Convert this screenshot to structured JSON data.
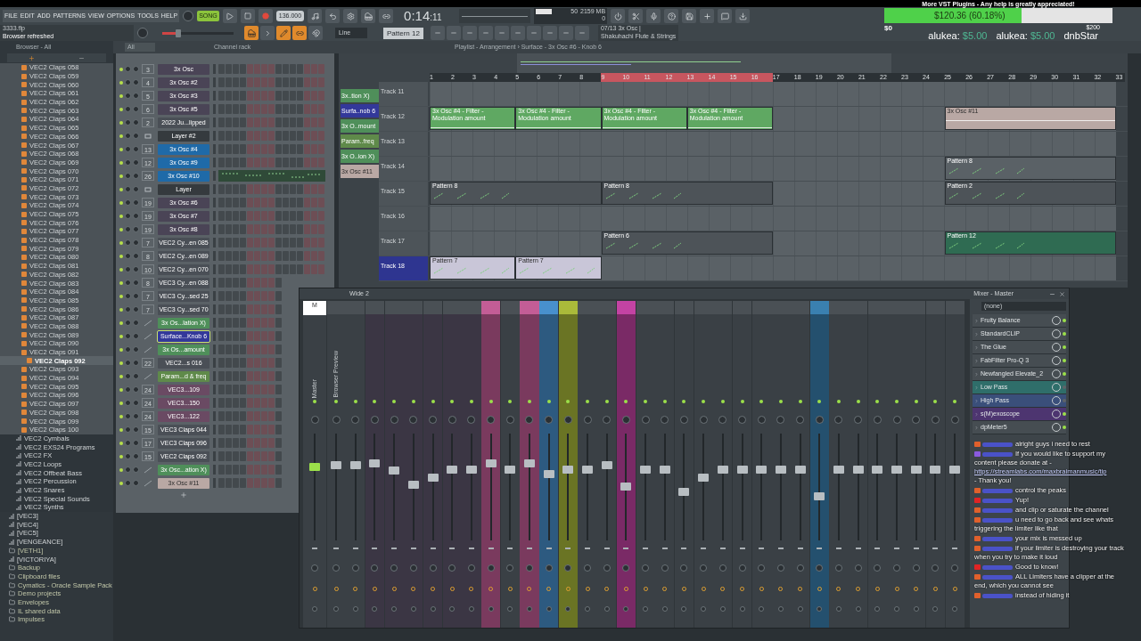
{
  "overlay": {
    "title": "More VST Plugins - Any help is greatly appreciated!",
    "amount": "$120.36 (60.18%)",
    "level": 0.6018,
    "min": "$0",
    "max": "$200",
    "donors": [
      {
        "name": "alukea:",
        "amount": "$5.00"
      },
      {
        "name": "alukea:",
        "amount": "$5.00"
      },
      {
        "name": "dnbStar"
      }
    ]
  },
  "toolbar": {
    "menu": [
      "FILE",
      "EDIT",
      "ADD",
      "PATTERNS",
      "VIEW",
      "OPTIONS",
      "TOOLS",
      "HELP"
    ],
    "mode": "SONG",
    "tempo": "136.000",
    "time": "0:14",
    "time_sub": ":11",
    "master_slider": {
      "level": 0.22
    },
    "cpu": "50",
    "memory": "2159 MB",
    "polyphony": "0",
    "project": "3333.flp",
    "status": "Browser refreshed",
    "snap": "Line",
    "pattern": "Pattern 12",
    "hint_top": "07/13  3x Osc |",
    "hint_bottom": "Shakuhachi Flute & Strings"
  },
  "browser": {
    "title": "Browser - All",
    "items": [
      {
        "name": "VEC2 Claps 058",
        "kind": "sample",
        "selected": false
      },
      {
        "name": "VEC2 Claps 059",
        "kind": "sample",
        "selected": false
      },
      {
        "name": "VEC2 Claps 060",
        "kind": "sample",
        "selected": false
      },
      {
        "name": "VEC2 Claps 061",
        "kind": "sample",
        "selected": false
      },
      {
        "name": "VEC2 Claps 062",
        "kind": "sample",
        "selected": false
      },
      {
        "name": "VEC2 Claps 063",
        "kind": "sample",
        "selected": false
      },
      {
        "name": "VEC2 Claps 064",
        "kind": "sample",
        "selected": false
      },
      {
        "name": "VEC2 Claps 065",
        "kind": "sample",
        "selected": false
      },
      {
        "name": "VEC2 Claps 066",
        "kind": "sample",
        "selected": false
      },
      {
        "name": "VEC2 Claps 067",
        "kind": "sample",
        "selected": false
      },
      {
        "name": "VEC2 Claps 068",
        "kind": "sample",
        "selected": false
      },
      {
        "name": "VEC2 Claps 069",
        "kind": "sample",
        "selected": false
      },
      {
        "name": "VEC2 Claps 070",
        "kind": "sample",
        "selected": false
      },
      {
        "name": "VEC2 Claps 071",
        "kind": "sample",
        "selected": false
      },
      {
        "name": "VEC2 Claps 072",
        "kind": "sample",
        "selected": false
      },
      {
        "name": "VEC2 Claps 073",
        "kind": "sample",
        "selected": false
      },
      {
        "name": "VEC2 Claps 074",
        "kind": "sample",
        "selected": false
      },
      {
        "name": "VEC2 Claps 075",
        "kind": "sample",
        "selected": false
      },
      {
        "name": "VEC2 Claps 076",
        "kind": "sample",
        "selected": false
      },
      {
        "name": "VEC2 Claps 077",
        "kind": "sample",
        "selected": false
      },
      {
        "name": "VEC2 Claps 078",
        "kind": "sample",
        "selected": false
      },
      {
        "name": "VEC2 Claps 079",
        "kind": "sample",
        "selected": false
      },
      {
        "name": "VEC2 Claps 080",
        "kind": "sample",
        "selected": false
      },
      {
        "name": "VEC2 Claps 081",
        "kind": "sample",
        "selected": false
      },
      {
        "name": "VEC2 Claps 082",
        "kind": "sample",
        "selected": false
      },
      {
        "name": "VEC2 Claps 083",
        "kind": "sample",
        "selected": false
      },
      {
        "name": "VEC2 Claps 084",
        "kind": "sample",
        "selected": false
      },
      {
        "name": "VEC2 Claps 085",
        "kind": "sample",
        "selected": false
      },
      {
        "name": "VEC2 Claps 086",
        "kind": "sample",
        "selected": false
      },
      {
        "name": "VEC2 Claps 087",
        "kind": "sample",
        "selected": false
      },
      {
        "name": "VEC2 Claps 088",
        "kind": "sample",
        "selected": false
      },
      {
        "name": "VEC2 Claps 089",
        "kind": "sample",
        "selected": false
      },
      {
        "name": "VEC2 Claps 090",
        "kind": "sample",
        "selected": false
      },
      {
        "name": "VEC2 Claps 091",
        "kind": "sample",
        "selected": false
      },
      {
        "name": "VEC2 Claps 092",
        "kind": "sample",
        "selected": true
      },
      {
        "name": "VEC2 Claps 093",
        "kind": "sample",
        "selected": false
      },
      {
        "name": "VEC2 Claps 094",
        "kind": "sample",
        "selected": false
      },
      {
        "name": "VEC2 Claps 095",
        "kind": "sample",
        "selected": false
      },
      {
        "name": "VEC2 Claps 096",
        "kind": "sample",
        "selected": false
      },
      {
        "name": "VEC2 Claps 097",
        "kind": "sample",
        "selected": false
      },
      {
        "name": "VEC2 Claps 098",
        "kind": "sample",
        "selected": false
      },
      {
        "name": "VEC2 Claps 099",
        "kind": "sample",
        "selected": false
      },
      {
        "name": "VEC2 Claps 100",
        "kind": "sample",
        "selected": false
      },
      {
        "name": "VEC2 Cymbals",
        "kind": "subfolder",
        "selected": false
      },
      {
        "name": "VEC2 EXS24 Programs",
        "kind": "subfolder",
        "selected": false
      },
      {
        "name": "VEC2 FX",
        "kind": "subfolder",
        "selected": false
      },
      {
        "name": "VEC2 Loops",
        "kind": "subfolder",
        "selected": false
      },
      {
        "name": "VEC2 Offbeat Bass",
        "kind": "subfolder",
        "selected": false
      },
      {
        "name": "VEC2 Percussion",
        "kind": "subfolder",
        "selected": false
      },
      {
        "name": "VEC2 Snares",
        "kind": "subfolder",
        "selected": false
      },
      {
        "name": "VEC2 Special Sounds",
        "kind": "subfolder",
        "selected": false
      },
      {
        "name": "VEC2 Synths",
        "kind": "subfolder",
        "selected": false
      },
      {
        "name": "[VEC3]",
        "kind": "pack",
        "selected": false
      },
      {
        "name": "[VEC4]",
        "kind": "pack",
        "selected": false
      },
      {
        "name": "[VEC5]",
        "kind": "pack",
        "selected": false
      },
      {
        "name": "[VENGEANCE]",
        "kind": "pack",
        "selected": false
      },
      {
        "name": "[VETH1]",
        "kind": "folder",
        "selected": false
      },
      {
        "name": "[VICTORIYA]",
        "kind": "pack",
        "selected": false
      },
      {
        "name": "Backup",
        "kind": "folder",
        "selected": false
      },
      {
        "name": "Clipboard files",
        "kind": "folder",
        "selected": false
      },
      {
        "name": "Cymatics - Oracle Sample Pack",
        "kind": "folder",
        "selected": false
      },
      {
        "name": "Demo projects",
        "kind": "folder",
        "selected": false
      },
      {
        "name": "Envelopes",
        "kind": "folder",
        "selected": false
      },
      {
        "name": "IL shared data",
        "kind": "folder",
        "selected": false
      },
      {
        "name": "Impulses",
        "kind": "folder",
        "selected": false
      }
    ]
  },
  "channel_rack": {
    "title": "Channel rack",
    "filter": "All",
    "channels": [
      {
        "number": "3",
        "name": "3x Osc",
        "kind": "instrument",
        "color": "#4a4456",
        "selected": false
      },
      {
        "number": "4",
        "name": "3x Osc #2",
        "kind": "instrument",
        "color": "#4a4456",
        "selected": false
      },
      {
        "number": "5",
        "name": "3x Osc #3",
        "kind": "instrument",
        "color": "#4a4456",
        "selected": false
      },
      {
        "number": "6",
        "name": "3x Osc #5",
        "kind": "instrument",
        "color": "#4a4456",
        "selected": false
      },
      {
        "number": "2",
        "name": "2022 Ju...lipped",
        "kind": "instrument",
        "color": "#4a4f56",
        "selected": false
      },
      {
        "name": "Layer #2",
        "kind": "layer",
        "color": "#353a3e",
        "selected": false
      },
      {
        "number": "13",
        "name": "3x Osc #4",
        "kind": "instrument",
        "color": "#1f6aa8",
        "selected": false
      },
      {
        "number": "12",
        "name": "3x Osc #9",
        "kind": "instrument",
        "color": "#1f6aa8",
        "selected": false
      },
      {
        "number": "26",
        "name": "3x Osc #10",
        "kind": "pianoroll",
        "color": "#1f6aa8",
        "selected": false
      },
      {
        "name": "Layer",
        "kind": "layer",
        "color": "#353a3e",
        "selected": false
      },
      {
        "number": "19",
        "name": "3x Osc #6",
        "kind": "instrument",
        "color": "#4a4456",
        "selected": false
      },
      {
        "number": "19",
        "name": "3x Osc #7",
        "kind": "instrument",
        "color": "#4a4456",
        "selected": false
      },
      {
        "number": "19",
        "name": "3x Osc #8",
        "kind": "instrument",
        "color": "#4a4456",
        "selected": false
      },
      {
        "number": "7",
        "name": "VEC2 Cy...en 085",
        "kind": "instrument",
        "color": "#4a4f56",
        "selected": false
      },
      {
        "number": "8",
        "name": "VEC2 Cy...en 089",
        "kind": "instrument",
        "color": "#4a4f56",
        "selected": false
      },
      {
        "number": "10",
        "name": "VEC2 Cy...en 070",
        "kind": "instrument",
        "color": "#4a4f56",
        "selected": false
      },
      {
        "number": "8",
        "name": "VEC3 Cy...en 088",
        "kind": "instrument",
        "color": "#4a4f56",
        "selected": false
      },
      {
        "number": "7",
        "name": "VEC3 Cy...sed 25",
        "kind": "instrument",
        "color": "#4a4f56",
        "selected": false
      },
      {
        "number": "7",
        "name": "VEC3 Cy...sed 70",
        "kind": "instrument",
        "color": "#4a4f56",
        "selected": false
      },
      {
        "name": "3x Os...lation X)",
        "kind": "automation",
        "color": "#4f8f5a",
        "selected": false
      },
      {
        "name": "Surface...Knob 6",
        "kind": "automation",
        "color": "#33389a",
        "selected": true
      },
      {
        "name": "3x Os...amount",
        "kind": "automation",
        "color": "#4f8f5a",
        "selected": false
      },
      {
        "number": "22",
        "name": "VEC2...s 016",
        "kind": "sampler",
        "color": "#4a4f56",
        "selected": false
      },
      {
        "name": "Param...d & freq",
        "kind": "automation",
        "color": "#5f8a4a",
        "selected": false
      },
      {
        "number": "24",
        "name": "VEC3...109",
        "kind": "sampler",
        "color": "#6a4a63",
        "selected": false
      },
      {
        "number": "24",
        "name": "VEC3...150",
        "kind": "sampler",
        "color": "#6a4a63",
        "selected": false
      },
      {
        "number": "24",
        "name": "VEC3...122",
        "kind": "sampler",
        "color": "#6a4a63",
        "selected": false
      },
      {
        "number": "15",
        "name": "VEC3 Claps 044",
        "kind": "instrument",
        "color": "#4a4f56",
        "selected": false
      },
      {
        "number": "17",
        "name": "VEC3 Claps 096",
        "kind": "instrument",
        "color": "#4a4f56",
        "selected": false
      },
      {
        "number": "15",
        "name": "VEC2 Claps 092",
        "kind": "instrument",
        "color": "#4a4f56",
        "selected": false
      },
      {
        "name": "3x Osc...ation X)",
        "kind": "automation",
        "color": "#4f8f5a",
        "selected": false
      },
      {
        "name": "3x Osc #11",
        "kind": "automation",
        "color": "#b9a8a4",
        "selected": false
      }
    ]
  },
  "playlist": {
    "title": "Playlist - Arrangement › Surface - 3x Osc #6 - Knob 6",
    "picker": [
      {
        "name": "3x..tion X)",
        "color": "#4f8f5a"
      },
      {
        "name": "Surfa..nob 6",
        "color": "#33389a"
      },
      {
        "name": "3x O..mount",
        "color": "#4f8f5a"
      },
      {
        "name": "Param..freq",
        "color": "#5f8a4a"
      },
      {
        "name": "3x O..ion X)",
        "color": "#4f8f5a"
      },
      {
        "name": "3x Osc #11",
        "color": "#b9a8a4"
      }
    ],
    "ruler": [
      {
        "label": "1",
        "selected": false
      },
      {
        "label": "2",
        "selected": false
      },
      {
        "label": "3",
        "selected": false
      },
      {
        "label": "4",
        "selected": false
      },
      {
        "label": "5",
        "selected": false
      },
      {
        "label": "6",
        "selected": false
      },
      {
        "label": "7",
        "selected": false
      },
      {
        "label": "8",
        "selected": false
      },
      {
        "label": "9",
        "selected": true
      },
      {
        "label": "10",
        "selected": true
      },
      {
        "label": "11",
        "selected": true
      },
      {
        "label": "12",
        "selected": true
      },
      {
        "label": "13",
        "selected": true
      },
      {
        "label": "14",
        "selected": true
      },
      {
        "label": "15",
        "selected": true
      },
      {
        "label": "16",
        "selected": true
      },
      {
        "label": "17",
        "selected": false
      },
      {
        "label": "18",
        "selected": false
      },
      {
        "label": "19",
        "selected": false
      },
      {
        "label": "20",
        "selected": false
      },
      {
        "label": "21",
        "selected": false
      },
      {
        "label": "22",
        "selected": false
      },
      {
        "label": "23",
        "selected": false
      },
      {
        "label": "24",
        "selected": false
      },
      {
        "label": "25",
        "selected": false
      },
      {
        "label": "26",
        "selected": false
      },
      {
        "label": "27",
        "selected": false
      },
      {
        "label": "28",
        "selected": false
      },
      {
        "label": "29",
        "selected": false
      },
      {
        "label": "30",
        "selected": false
      },
      {
        "label": "31",
        "selected": false
      },
      {
        "label": "32",
        "selected": false
      },
      {
        "label": "33",
        "selected": false
      }
    ],
    "tracks": [
      {
        "name": "Track 11",
        "selected": false
      },
      {
        "name": "Track 12",
        "selected": false,
        "cells": [
          {
            "label": "3x Osc #4 - Filter - Modulation amount",
            "kind": "automation",
            "color": "#5fa862"
          },
          {
            "label": "3x Osc #4 - Filter - Modulation amount",
            "kind": "automation",
            "color": "#5fa862"
          },
          {
            "label": "3x Osc #4 - Filter - Modulation amount",
            "kind": "automation",
            "color": "#5fa862"
          },
          {
            "label": "3x Osc #4 - Filter - Modulation amount",
            "kind": "automation",
            "color": "#5fa862"
          },
          {
            "kind": "empty"
          },
          {
            "kind": "empty"
          },
          {
            "label": "3x Osc #11",
            "kind": "automation",
            "color": "#b9a8a4"
          },
          {
            "kind": "continued"
          }
        ]
      },
      {
        "name": "Track 13",
        "selected": false
      },
      {
        "name": "Track 14",
        "selected": false,
        "cells": [
          {
            "kind": "empty"
          },
          {
            "kind": "empty"
          },
          {
            "kind": "empty"
          },
          {
            "kind": "empty"
          },
          {
            "kind": "empty"
          },
          {
            "kind": "empty"
          },
          {
            "label": "Pattern 8",
            "kind": "pattern",
            "color": "#5a6166"
          },
          {
            "kind": "continued"
          }
        ]
      },
      {
        "name": "Track 15",
        "selected": false,
        "cells": [
          {
            "label": "Pattern 8",
            "kind": "pattern",
            "color": "#4d5358"
          },
          {
            "kind": "continued"
          },
          {
            "label": "Pattern 8",
            "kind": "pattern",
            "color": "#4d5358"
          },
          {
            "kind": "continued"
          },
          {
            "kind": "empty"
          },
          {
            "kind": "empty"
          },
          {
            "label": "Pattern 2",
            "kind": "pattern",
            "color": "#4d5358"
          },
          {
            "kind": "continued"
          }
        ]
      },
      {
        "name": "Track 16",
        "selected": false
      },
      {
        "name": "Track 17",
        "selected": false,
        "cells": [
          {
            "kind": "empty"
          },
          {
            "kind": "empty"
          },
          {
            "label": "Pattern 6",
            "kind": "pattern",
            "color": "#4d5358"
          },
          {
            "kind": "continued"
          },
          {
            "kind": "empty"
          },
          {
            "kind": "empty"
          },
          {
            "label": "Pattern 12",
            "kind": "pattern",
            "color": "#2f6b52"
          },
          {
            "kind": "continued"
          }
        ]
      },
      {
        "name": "Track 18",
        "selected": true,
        "cells": [
          {
            "label": "Pattern 7",
            "kind": "pattern",
            "color": "#c9c6d8"
          },
          {
            "label": "Pattern 7",
            "kind": "pattern",
            "color": "#c9c6d8"
          }
        ]
      }
    ]
  },
  "mixer": {
    "title": "Wide 2",
    "strips": [
      {
        "number": "M",
        "label": "Master",
        "level": 0.68
      },
      {
        "label": "Browser Preview",
        "level": 0.7
      },
      {
        "level": 0.7
      },
      {
        "level": 0.72
      },
      {
        "level": 0.65
      },
      {
        "level": 0.52
      },
      {
        "level": 0.58
      },
      {
        "level": 0.66
      },
      {
        "level": 0.66
      },
      {
        "level": 0.72,
        "color": "#7a3a5e"
      },
      {
        "level": 0.66
      },
      {
        "level": 0.72,
        "color": "#7a3a5e"
      },
      {
        "level": 0.62,
        "color": "#2d5a80"
      },
      {
        "level": 0.66,
        "color": "#6a7424"
      },
      {
        "level": 0.66
      },
      {
        "level": 0.7
      },
      {
        "level": 0.5,
        "color": "#7a2a66"
      },
      {
        "level": 0.66
      },
      {
        "level": 0.66
      },
      {
        "level": 0.45
      },
      {
        "level": 0.58
      },
      {
        "level": 0.66
      },
      {
        "level": 0.66
      },
      {
        "level": 0.66
      },
      {
        "level": 0.66
      },
      {
        "level": 0.66
      },
      {
        "level": 0.41,
        "color": "#24506e"
      },
      {
        "level": 0.66
      },
      {
        "level": 0.66
      },
      {
        "level": 0.66
      },
      {
        "level": 0.66
      },
      {
        "level": 0.66
      },
      {
        "level": 0.66
      },
      {
        "level": 0.66
      }
    ],
    "inserts_title": "Mixer - Master",
    "input": "(none)",
    "inserts": [
      {
        "name": "Fruity Balance",
        "on": true
      },
      {
        "name": "StandardCLIP",
        "on": true
      },
      {
        "name": "The Glue",
        "on": true
      },
      {
        "name": "FabFilter Pro-Q 3",
        "on": true
      },
      {
        "name": "Newfangled Elevate_2",
        "on": true
      },
      {
        "name": "Low  Pass",
        "on": false,
        "color": "#2f6e6a"
      },
      {
        "name": "High Pass",
        "on": false,
        "color": "#3a4f7a"
      },
      {
        "name": "s(M)exoscope",
        "on": true,
        "color": "#4d3570"
      },
      {
        "name": "dpMeter5",
        "on": true
      }
    ]
  },
  "chat": [
    {
      "kind": "restream",
      "text": "alright guys i need to rest"
    },
    {
      "kind": "bot",
      "text": "If you would like to support my content please donate at - ",
      "link": "https://streamlabs.com/maxbraimanmusic/tip",
      "after": " - Thank you!"
    },
    {
      "kind": "restream",
      "text": "control the peaks"
    },
    {
      "kind": "youtube",
      "text": "Yup!"
    },
    {
      "kind": "restream",
      "text": "and clip or saturate the channel"
    },
    {
      "kind": "restream",
      "text": "u need to go back and see whats triggering the limiter like that"
    },
    {
      "kind": "restream",
      "text": "your mix is messed up"
    },
    {
      "kind": "restream",
      "text": "if your limiter is destroying your track when you try to make it loud"
    },
    {
      "kind": "youtube",
      "text": "Good to know!"
    },
    {
      "kind": "restream",
      "text": "ALL Limiters have a clipper at the end, which you cannot see"
    },
    {
      "kind": "restream",
      "text": "instead of hiding it"
    }
  ]
}
